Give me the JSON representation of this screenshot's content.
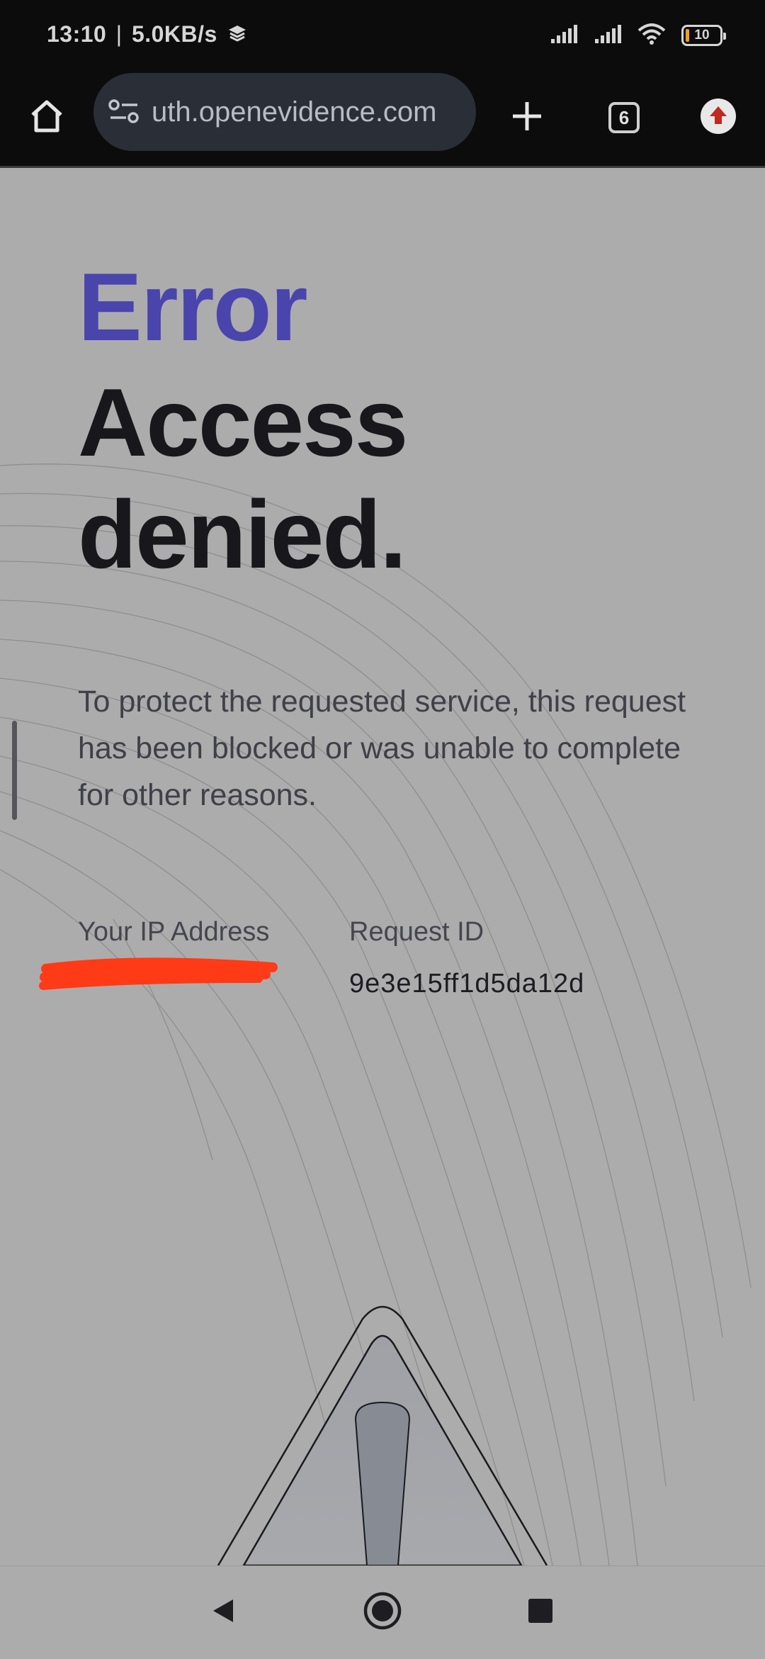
{
  "status_bar": {
    "time": "13:10",
    "net_speed": "5.0KB/s",
    "battery_level": "10",
    "separator": "|"
  },
  "browser": {
    "url": "uth.openevidence.com",
    "tab_count": "6"
  },
  "page": {
    "error_label": "Error",
    "heading_line1": "Access",
    "heading_line2": "denied.",
    "message": "To protect the requested service, this request has been blocked or was unable to complete for other reasons.",
    "ip_label": "Your IP Address",
    "request_id_label": "Request ID",
    "request_id_value": "9e3e15ff1d5da12d"
  },
  "colors": {
    "accent": "#4a44ad",
    "background": "#acacac",
    "redaction": "#ff3a17",
    "chrome": "#0c0c0d"
  }
}
